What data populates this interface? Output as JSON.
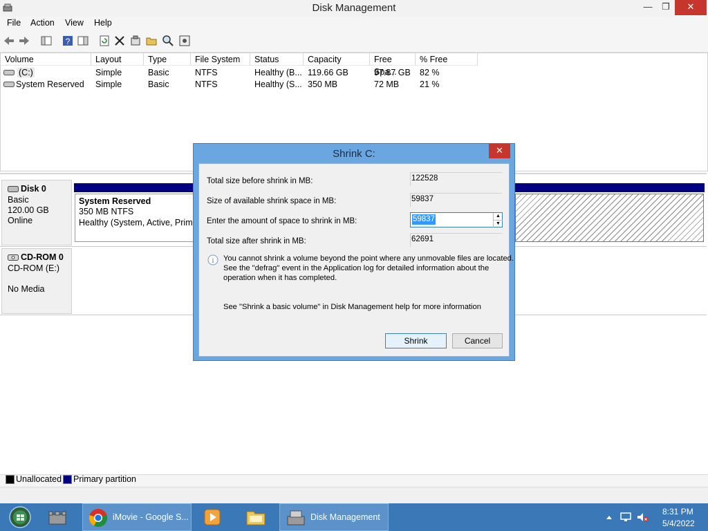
{
  "window": {
    "title": "Disk Management"
  },
  "menu": [
    "File",
    "Action",
    "View",
    "Help"
  ],
  "volumes": {
    "columns": [
      "Volume",
      "Layout",
      "Type",
      "File System",
      "Status",
      "Capacity",
      "Free Spa...",
      "% Free"
    ],
    "rows": [
      [
        "(C:)",
        "Simple",
        "Basic",
        "NTFS",
        "Healthy (B...",
        "119.66 GB",
        "97.87 GB",
        "82 %"
      ],
      [
        "System Reserved",
        "Simple",
        "Basic",
        "NTFS",
        "Healthy (S...",
        "350 MB",
        "72 MB",
        "21 %"
      ]
    ]
  },
  "disks": {
    "disk0": {
      "name": "Disk 0",
      "type": "Basic",
      "size": "120.00 GB",
      "status": "Online"
    },
    "sysres": {
      "name": "System Reserved",
      "size": "350 MB NTFS",
      "status": "Healthy (System, Active, Primar"
    },
    "cdrom": {
      "name": "CD-ROM 0",
      "drive": "CD-ROM (E:)",
      "media": "No Media"
    }
  },
  "legend": {
    "unallocated": "Unallocated",
    "primary": "Primary partition"
  },
  "dialog": {
    "title": "Shrink C:",
    "label_total_before": "Total size before shrink in MB:",
    "value_total_before": "122528",
    "label_available": "Size of available shrink space in MB:",
    "value_available": "59837",
    "label_amount": "Enter the amount of space to shrink in MB:",
    "value_amount": "59837",
    "label_total_after": "Total size after shrink in MB:",
    "value_total_after": "62691",
    "info_text_1": "You cannot shrink a volume beyond the point where any unmovable files are located.",
    "info_text_2": "See the \"defrag\" event in the Application log for detailed information about the",
    "info_text_3": "operation when it has completed.",
    "help_text": "See \"Shrink a basic volume\" in Disk Management help for more information",
    "shrink_button": "Shrink",
    "cancel_button": "Cancel"
  },
  "taskbar": {
    "chrome_label": "iMovie - Google S...",
    "diskmgmt_label": "Disk Management",
    "time": "8:31 PM",
    "date": "5/4/2022"
  },
  "colors": {
    "primary_partition": "#000080",
    "taskbar": "#3a78b8",
    "dialog_frame": "#6aa6e0",
    "close_button": "#c7362c"
  }
}
